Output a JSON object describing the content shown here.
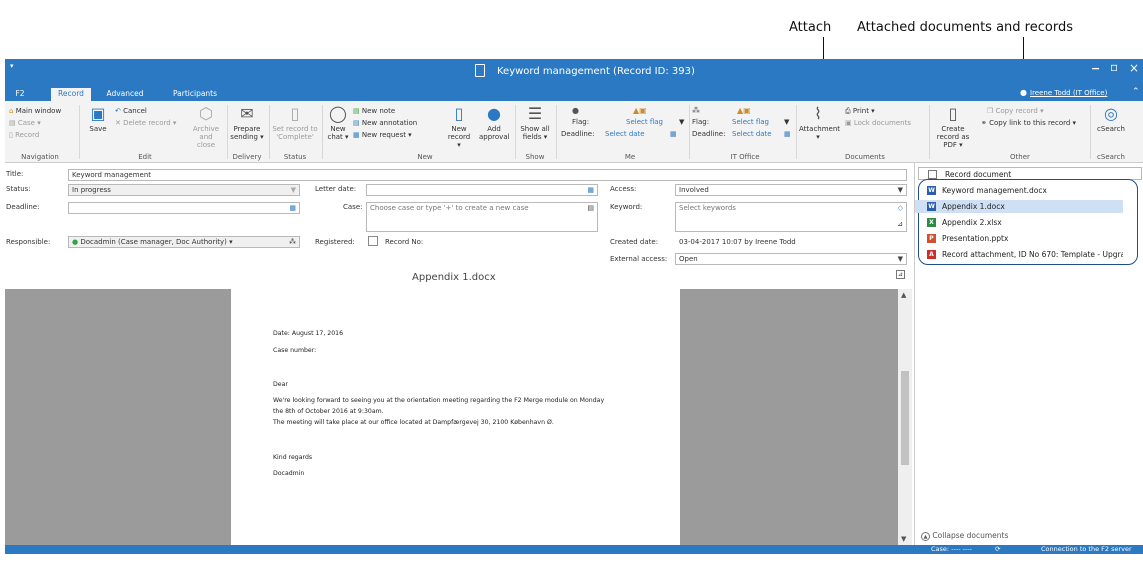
{
  "callouts": {
    "attach": "Attach",
    "attached": "Attached documents and records"
  },
  "window": {
    "title": "Keyword management (Record ID: 393)",
    "user": "Ireene Todd (IT Office)",
    "minimize": "−",
    "maximize": "▫",
    "close": "×"
  },
  "tabs": [
    "F2",
    "Record",
    "Advanced",
    "Participants"
  ],
  "ribbon": {
    "nav": {
      "main_window": "Main window",
      "case": "Case ▾",
      "record": "Record",
      "label": "Navigation"
    },
    "edit": {
      "save": "Save",
      "cancel": "Cancel",
      "delete": "Delete record ▾",
      "archive": "Archive and close",
      "label": "Edit"
    },
    "delivery": {
      "prepare": "Prepare sending ▾",
      "label": "Delivery"
    },
    "status": {
      "set": "Set record to 'Complete'",
      "label": "Status"
    },
    "new": {
      "chat": "New chat ▾",
      "note": "New note",
      "annotation": "New annotation",
      "request": "New request ▾",
      "new_record": "New record ▾",
      "approval": "Add approval",
      "label": "New"
    },
    "show": {
      "fields": "Show all fields ▾",
      "label": "Show"
    },
    "me": {
      "flag": "Flag:",
      "flag_val": "Select flag",
      "deadline": "Deadline:",
      "deadline_val": "Select date",
      "label": "Me"
    },
    "it": {
      "flag": "Flag:",
      "flag_val": "Select flag",
      "deadline": "Deadline:",
      "deadline_val": "Select date",
      "label": "IT Office"
    },
    "docs": {
      "attachment": "Attachment ▾",
      "print": "Print ▾",
      "lock": "Lock documents",
      "label": "Documents"
    },
    "other": {
      "pdf": "Create record as PDF ▾",
      "copy": "Copy record ▾",
      "copylink": "Copy link to this record ▾",
      "label": "Other"
    },
    "csearch": {
      "btn": "cSearch",
      "label": "cSearch"
    }
  },
  "form": {
    "title_label": "Title:",
    "title_value": "Keyword management",
    "status_label": "Status:",
    "status_value": "In progress",
    "deadline_label": "Deadline:",
    "responsible_label": "Responsible:",
    "responsible_value": "Docadmin (Case manager, Doc Authority) ▾",
    "letter_label": "Letter date:",
    "case_label": "Case:",
    "case_ph": "Choose case or type '+' to create a new case",
    "registered_label": "Registered:",
    "record_no": "Record No:",
    "access_label": "Access:",
    "access_value": "Involved",
    "keyword_label": "Keyword:",
    "keyword_ph": "Select keywords",
    "created_label": "Created date:",
    "created_value": "03-04-2017 10:07  by  Ireene Todd",
    "ext_label": "External access:",
    "ext_value": "Open"
  },
  "preview": {
    "title": "Appendix 1.docx",
    "lines": [
      "Date: August 17, 2016",
      "Case number:",
      "Dear",
      "We're looking forward to seeing you at the orientation meeting regarding the F2 Merge module on Monday",
      "the 8th of October 2016 at 9:30am.",
      "The meeting will take place at our office located at Dampfærgevej 30, 2100 København Ø.",
      "Kind regards",
      "Docadmin"
    ]
  },
  "documents": {
    "record_document": "Record document",
    "items": [
      "Keyword management.docx",
      "Appendix 1.docx",
      "Appendix 2.xlsx",
      "Presentation.pptx",
      "Record attachment, ID No 670: Template - Upgrade m..."
    ],
    "collapse": "Collapse documents"
  },
  "status": {
    "case": "Case: ---- ----",
    "connection": "Connection to the F2 server OK"
  },
  "colors": {
    "accent": "#2b79c2",
    "selected": "#cfe0f4"
  }
}
